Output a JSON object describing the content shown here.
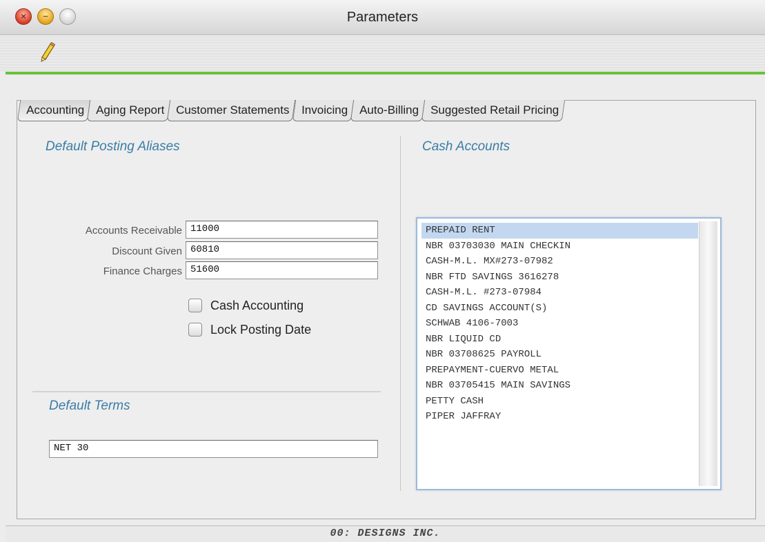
{
  "window": {
    "title": "Parameters"
  },
  "tabs": [
    {
      "label": "Accounting",
      "active": true
    },
    {
      "label": "Aging Report"
    },
    {
      "label": "Customer Statements"
    },
    {
      "label": "Invoicing"
    },
    {
      "label": "Auto-Billing"
    },
    {
      "label": "Suggested Retail Pricing"
    }
  ],
  "posting": {
    "heading": "Default Posting Aliases",
    "fields": [
      {
        "label": "Accounts Receivable",
        "value": "11000"
      },
      {
        "label": "Discount Given",
        "value": "60810"
      },
      {
        "label": "Finance Charges",
        "value": "51600"
      }
    ],
    "checkboxes": [
      {
        "label": "Cash Accounting",
        "checked": false
      },
      {
        "label": "Lock Posting Date",
        "checked": false
      }
    ]
  },
  "terms": {
    "heading": "Default Terms",
    "value": "NET 30"
  },
  "cash_accounts": {
    "heading": "Cash Accounts",
    "items": [
      "PREPAID RENT",
      "NBR 03703030 MAIN CHECKIN",
      "CASH-M.L. MX#273-07982",
      "NBR FTD SAVINGS 3616278",
      "CASH-M.L. #273-07984",
      "CD SAVINGS ACCOUNT(S)",
      "SCHWAB 4106-7003",
      "NBR LIQUID CD",
      "NBR 03708625 PAYROLL",
      "PREPAYMENT-CUERVO METAL",
      "NBR 03705415 MAIN SAVINGS",
      "PETTY CASH",
      "PIPER JAFFRAY"
    ],
    "selected_index": 0
  },
  "footer": {
    "text": "00:  DESIGNS INC."
  },
  "colors": {
    "accent_green": "#6ac13b",
    "heading_blue": "#3a7da6",
    "selection": "#c3d8f0"
  },
  "icons": {
    "toolbar": "pencil-icon"
  }
}
